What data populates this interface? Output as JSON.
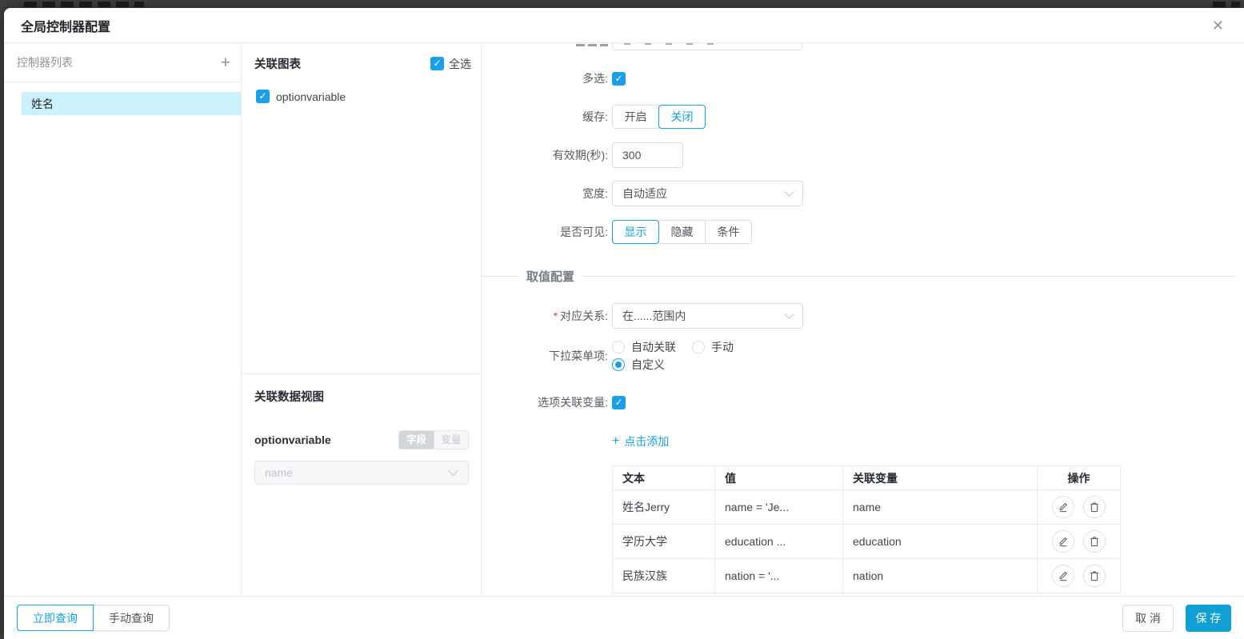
{
  "dialog": {
    "title": "全局控制器配置",
    "close_icon": "✕"
  },
  "controller_panel": {
    "title": "控制器列表",
    "add_icon": "+",
    "items": [
      {
        "label": "姓名",
        "selected": true
      }
    ]
  },
  "charts_panel": {
    "title": "关联图表",
    "select_all_label": "全选",
    "select_all_checked": true,
    "charts": [
      {
        "label": "optionvariable",
        "checked": true
      }
    ]
  },
  "dataview_panel": {
    "title": "关联数据视图",
    "view_name": "optionvariable",
    "modes": [
      "字段",
      "变量"
    ],
    "selected_mode": "字段",
    "field_select_value": "name",
    "field_select_disabled": true
  },
  "form": {
    "multi_select": {
      "label": "多选:",
      "checked": true
    },
    "cache": {
      "label": "缓存:",
      "options": [
        "开启",
        "关闭"
      ],
      "selected": "关闭"
    },
    "validity": {
      "label": "有效期(秒):",
      "value": "300"
    },
    "width": {
      "label": "宽度:",
      "value": "自动适应"
    },
    "visibility": {
      "label": "是否可见:",
      "options": [
        "显示",
        "隐藏",
        "条件"
      ],
      "selected": "显示"
    },
    "section_title": "取值配置",
    "relation": {
      "label": "对应关系:",
      "required_mark": "*",
      "value": "在......范围内"
    },
    "dropdown_items": {
      "label": "下拉菜单项:",
      "options": [
        "自动关联",
        "手动",
        "自定义"
      ],
      "selected": "自定义"
    },
    "option_variable": {
      "label": "选项关联变量:",
      "checked": true
    },
    "add_link": {
      "plus_icon": "+",
      "label": "点击添加"
    },
    "table": {
      "headers": [
        "文本",
        "值",
        "关联变量",
        "操作"
      ],
      "rows": [
        {
          "text": "姓名Jerry",
          "value": "name = 'Je...",
          "variable": "name"
        },
        {
          "text": "学历大学",
          "value": "education ...",
          "variable": "education"
        },
        {
          "text": "民族汉族",
          "value": "nation = '...",
          "variable": "nation"
        }
      ]
    }
  },
  "footer": {
    "query_now": "立即查询",
    "query_manual": "手动查询",
    "cancel": "取 消",
    "save": "保 存"
  },
  "colors": {
    "accent": "#17a0e0",
    "checkbox_blue": "#19a0e8",
    "save_button_bg": "#11a0d4",
    "selected_item_bg": "#cbf2fc"
  }
}
